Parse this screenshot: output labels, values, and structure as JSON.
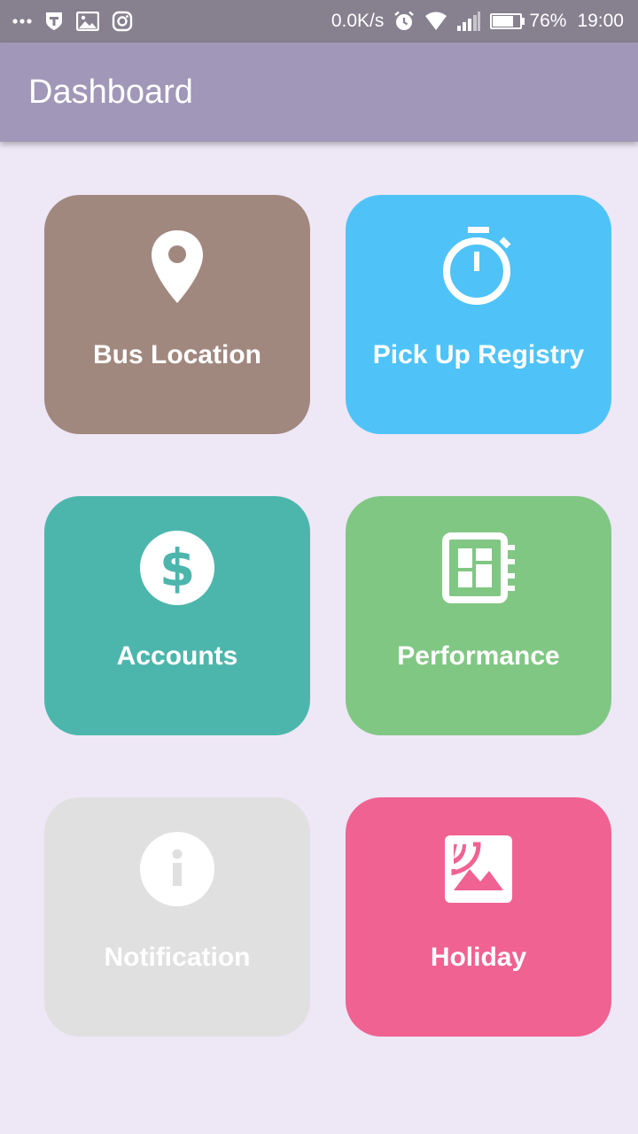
{
  "status_bar": {
    "net_speed": "0.0K/s",
    "battery": "76%",
    "time": "19:00",
    "icons": [
      "more-dots-icon",
      "vpn-shield-icon",
      "image-icon",
      "instagram-icon",
      "alarm-icon",
      "wifi-icon",
      "signal-icon",
      "battery-icon"
    ]
  },
  "app_bar": {
    "title": "Dashboard",
    "color": "#a197b8"
  },
  "tiles": [
    {
      "label": "Bus Location",
      "icon": "map-pin-icon",
      "color": "#a1887f"
    },
    {
      "label": "Pick Up Registry",
      "icon": "stopwatch-icon",
      "color": "#4fc3f7"
    },
    {
      "label": "Accounts",
      "icon": "dollar-circle-icon",
      "color": "#4db6ac"
    },
    {
      "label": "Performance",
      "icon": "dashboard-panel-icon",
      "color": "#81c784"
    },
    {
      "label": "Notification",
      "icon": "info-circle-icon",
      "color": "#e0e0e0"
    },
    {
      "label": "Holiday",
      "icon": "image-landscape-icon",
      "color": "#f06292"
    }
  ]
}
